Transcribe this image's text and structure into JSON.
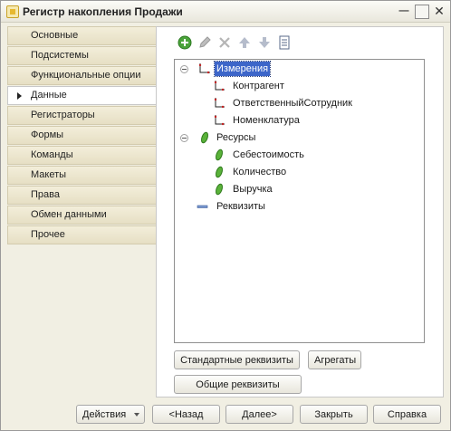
{
  "window": {
    "title": "Регистр накопления Продажи"
  },
  "nav": {
    "items": [
      {
        "label": "Основные"
      },
      {
        "label": "Подсистемы"
      },
      {
        "label": "Функциональные опции"
      },
      {
        "label": "Данные"
      },
      {
        "label": "Регистраторы"
      },
      {
        "label": "Формы"
      },
      {
        "label": "Команды"
      },
      {
        "label": "Макеты"
      },
      {
        "label": "Права"
      },
      {
        "label": "Обмен данными"
      },
      {
        "label": "Прочее"
      }
    ],
    "active": "Данные"
  },
  "toolbar": {
    "icons": [
      "add-icon",
      "edit-icon",
      "delete-icon",
      "move-up-icon",
      "move-down-icon",
      "list-icon"
    ]
  },
  "tree": {
    "dimensions": {
      "label": "Измерения",
      "children": [
        "Контрагент",
        "ОтветственныйСотрудник",
        "Номенклатура"
      ]
    },
    "resources": {
      "label": "Ресурсы",
      "children": [
        "Себестоимость",
        "Количество",
        "Выручка"
      ]
    },
    "attributes": {
      "label": "Реквизиты"
    }
  },
  "buttons": {
    "standard_attrs": "Стандартные реквизиты",
    "aggregates": "Агрегаты",
    "common_attrs": "Общие реквизиты"
  },
  "footer": {
    "actions": "Действия",
    "back": "<Назад",
    "next": "Далее>",
    "close": "Закрыть",
    "help": "Справка"
  },
  "colors": {
    "selection": "#3d66c9",
    "nav_tab": "#e6dfc4",
    "background": "#f1efe3"
  }
}
